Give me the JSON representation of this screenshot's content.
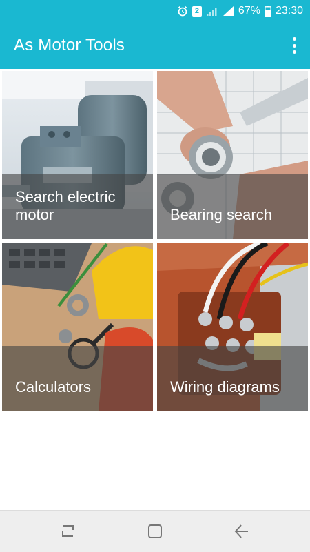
{
  "status_bar": {
    "alarm_icon": "alarm-clock-icon",
    "notification_count": "2",
    "battery_percent": "67%",
    "time": "23:30"
  },
  "app_bar": {
    "title": "As Motor Tools",
    "menu_icon": "more-vert-icon"
  },
  "tiles": [
    {
      "label": "Search electric motor"
    },
    {
      "label": "Bearing search"
    },
    {
      "label": "Calculators"
    },
    {
      "label": "Wiring diagrams"
    }
  ],
  "nav_bar": {
    "recents_icon": "recent-apps-icon",
    "home_icon": "home-icon",
    "back_icon": "back-arrow-icon"
  },
  "colors": {
    "primary": "#1ab8d1",
    "overlay": "#464646",
    "nav_bg": "#eeeeee"
  }
}
